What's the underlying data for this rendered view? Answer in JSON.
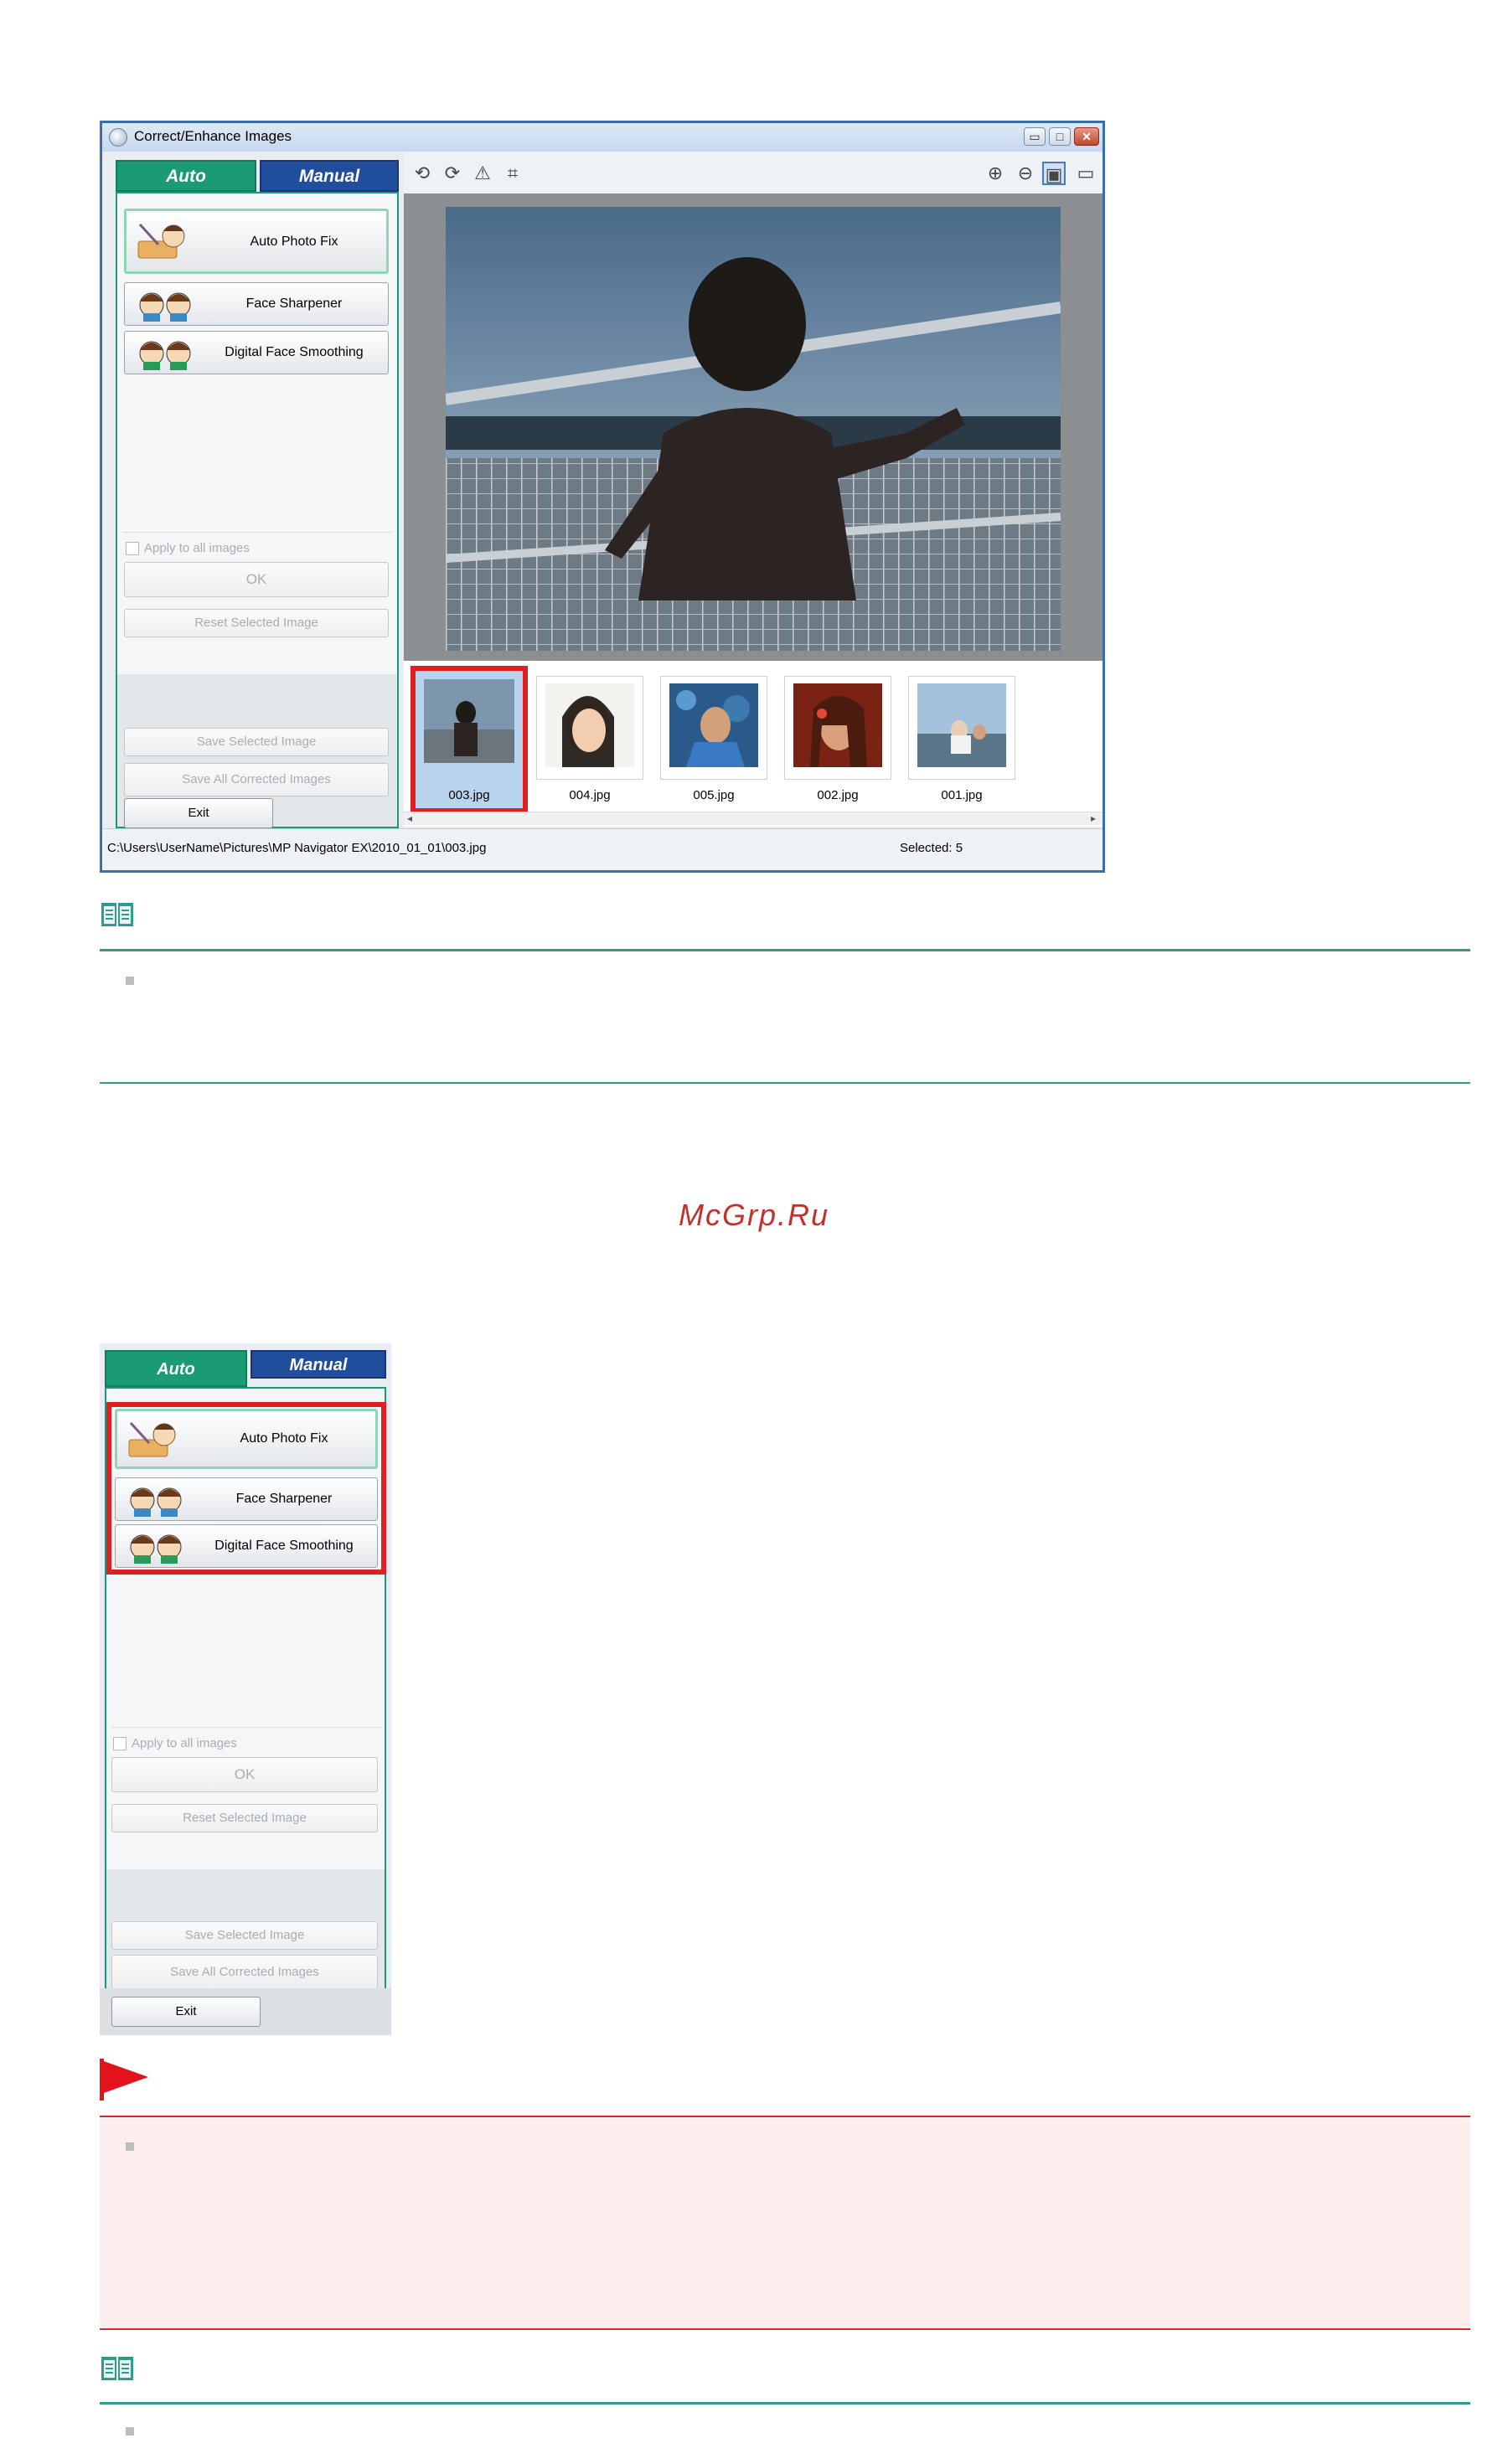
{
  "window": {
    "title": "Correct/Enhance Images",
    "controls": [
      "▭",
      "□",
      "✕"
    ],
    "tabs": {
      "auto": "Auto",
      "manual": "Manual"
    },
    "buttons": {
      "auto_photo_fix": "Auto Photo Fix",
      "face_sharpener": "Face Sharpener",
      "digital_face_smoothing": "Digital Face Smoothing",
      "apply_all": "Apply to all images",
      "ok": "OK",
      "reset_selected": "Reset Selected Image",
      "save_selected": "Save Selected Image",
      "save_all": "Save All Corrected Images",
      "exit": "Exit"
    },
    "toolbar_icons": [
      "rotate-left-icon",
      "rotate-right-icon",
      "flip-icon",
      "crop-icon",
      "zoom-in-icon",
      "zoom-out-icon",
      "whole-image-icon",
      "compare-icon"
    ],
    "thumbnails": [
      {
        "label": "003.jpg",
        "selected": true
      },
      {
        "label": "004.jpg",
        "selected": false
      },
      {
        "label": "005.jpg",
        "selected": false
      },
      {
        "label": "002.jpg",
        "selected": false
      },
      {
        "label": "001.jpg",
        "selected": false
      }
    ],
    "status": {
      "path": "C:\\Users\\UserName\\Pictures\\MP Navigator EX\\2010_01_01\\003.jpg",
      "selected": "Selected: 5"
    }
  },
  "watermark": "McGrp.Ru",
  "panel2": {
    "tabs": {
      "auto": "Auto",
      "manual": "Manual"
    },
    "buttons": {
      "auto_photo_fix": "Auto Photo Fix",
      "face_sharpener": "Face Sharpener",
      "digital_face_smoothing": "Digital Face Smoothing",
      "apply_all": "Apply to all images",
      "ok": "OK",
      "reset_selected": "Reset Selected Image",
      "save_selected": "Save Selected Image",
      "save_all": "Save All Corrected Images",
      "exit": "Exit"
    }
  },
  "colors": {
    "accent_green": "#1a9b73",
    "accent_blue": "#214d9d",
    "highlight_red": "#e02020",
    "note_teal": "#2e9c8c"
  }
}
